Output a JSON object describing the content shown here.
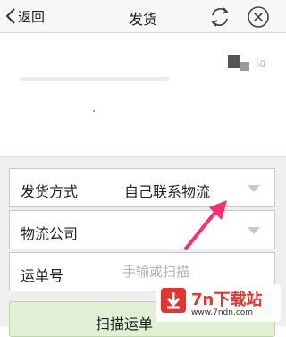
{
  "nav": {
    "back_label": "返回",
    "title": "发货"
  },
  "info": {
    "trail_text": "la"
  },
  "form": {
    "shipping_method": {
      "label": "发货方式",
      "value": "自己联系物流"
    },
    "logistics_company": {
      "label": "物流公司",
      "value": ""
    },
    "tracking_number": {
      "label": "运单号",
      "placeholder": "手输或扫描"
    }
  },
  "scan_button": {
    "label": "扫描运单"
  },
  "watermark": {
    "brand": "7n下载站",
    "url": "www.7ndn.com"
  },
  "colors": {
    "annotation_arrow": "#ff2d6f",
    "watermark_red": "#e3342f",
    "scan_button_bg": "#dff0d4"
  },
  "icons": [
    "chevron-left-icon",
    "refresh-icon",
    "close-circle-icon",
    "caret-down-icon",
    "download-icon"
  ]
}
